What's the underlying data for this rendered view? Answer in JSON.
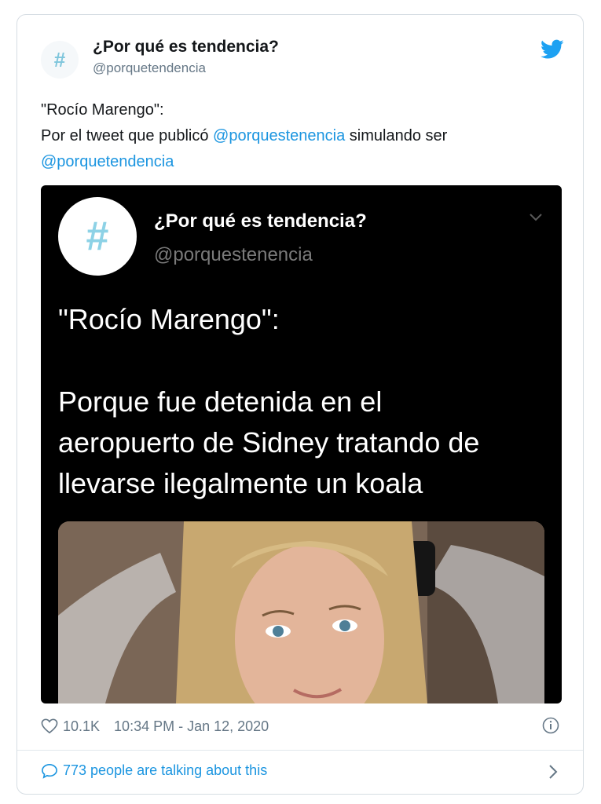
{
  "tweet": {
    "avatar_glyph": "#",
    "display_name": "¿Por qué es tendencia?",
    "handle": "@porquetendencia",
    "text_line1": "\"Rocío Marengo\":",
    "text_line2_prefix": "Por el tweet que publicó ",
    "text_line2_mention": "@porquestenencia",
    "text_line2_suffix": " simulando ser",
    "text_line3_mention": "@porquetendencia"
  },
  "embedded": {
    "avatar_glyph": "#",
    "display_name": "¿Por qué es tendencia?",
    "handle": "@porquestenencia",
    "quote": "\"Rocío Marengo\":",
    "body_lines": [
      "Porque fue detenida en el",
      "aeropuerto de Sidney tratando de",
      "llevarse ilegalmente un koala"
    ]
  },
  "footer": {
    "likes": "10.1K",
    "timestamp": "10:34 PM - Jan 12, 2020",
    "talking": "773 people are talking about this"
  },
  "colors": {
    "accent": "#1b95e0",
    "muted": "#657786",
    "hashtag": "#7fc6dc",
    "embed_bg": "#000000"
  },
  "icons": [
    "twitter-bird-icon",
    "chevron-down-icon",
    "heart-icon",
    "info-icon",
    "comment-bubble-icon",
    "chevron-right-icon"
  ]
}
